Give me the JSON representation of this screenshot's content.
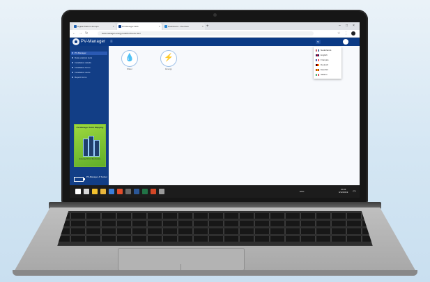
{
  "browser": {
    "tabs": [
      {
        "title": "Digital Platform Europe",
        "active": false
      },
      {
        "title": "PV-Manager Web",
        "active": true
      },
      {
        "title": "Dashboard - Overview",
        "active": false
      }
    ],
    "url": "www.manager.energy.tudelft.nl/menu.html"
  },
  "app": {
    "name": "PV-Manager",
    "menu_icon": "menu-icon",
    "lang_button": "Nl",
    "colors": {
      "header": "#0b3a85",
      "sidebar": "#123e86",
      "accent": "#1e63b4"
    }
  },
  "sidebar": {
    "items": [
      {
        "label": "PV-Manager",
        "active": true
      },
      {
        "label": "Data analysis tools",
        "active": false
      },
      {
        "label": "Installation details",
        "active": false
      },
      {
        "label": "Installation forms",
        "active": false
      },
      {
        "label": "Installation cards",
        "active": false
      },
      {
        "label": "Report forms",
        "active": false
      }
    ],
    "promo": {
      "title": "PV-Manager Solar Mapping",
      "subtitle": "Energy fit for the future"
    },
    "footer": {
      "label": "PV-Manager & Toolset"
    }
  },
  "main": {
    "tiles": [
      {
        "label": "Water",
        "icon": "water-drop-icon"
      },
      {
        "label": "Energy",
        "icon": "energy-bulb-icon"
      }
    ]
  },
  "language_menu": {
    "options": [
      {
        "label": "Nederlands",
        "flag": [
          "#ae1c28",
          "#ffffff",
          "#21468b"
        ]
      },
      {
        "label": "English",
        "flag": [
          "#012169",
          "#c8102e",
          "#012169"
        ]
      },
      {
        "label": "Français",
        "flag": [
          "#002395",
          "#ffffff",
          "#ed2939"
        ]
      },
      {
        "label": "Deutsch",
        "flag": [
          "#000000",
          "#dd0000",
          "#ffce00"
        ]
      },
      {
        "label": "Español",
        "flag": [
          "#aa151b",
          "#f1bf00",
          "#aa151b"
        ]
      },
      {
        "label": "Italiano",
        "flag": [
          "#009246",
          "#ffffff",
          "#ce2b37"
        ]
      }
    ]
  },
  "taskbar": {
    "apps": [
      {
        "name": "start-icon",
        "color": "#ffffff"
      },
      {
        "name": "search-icon",
        "color": "#d9d9d9"
      },
      {
        "name": "explorer-icon",
        "color": "#f2c12e"
      },
      {
        "name": "folder-icon",
        "color": "#e8b63c"
      },
      {
        "name": "mail-icon",
        "color": "#3b7dd8"
      },
      {
        "name": "browser-icon",
        "color": "#e34d2b"
      },
      {
        "name": "store-icon",
        "color": "#6a6a6a"
      },
      {
        "name": "word-icon",
        "color": "#2b5797"
      },
      {
        "name": "excel-icon",
        "color": "#217346"
      },
      {
        "name": "powerpoint-icon",
        "color": "#d24726"
      },
      {
        "name": "settings-icon",
        "color": "#9a9a9a"
      }
    ],
    "tray": "ENG",
    "time": "10:24",
    "date": "6/12/2019"
  }
}
